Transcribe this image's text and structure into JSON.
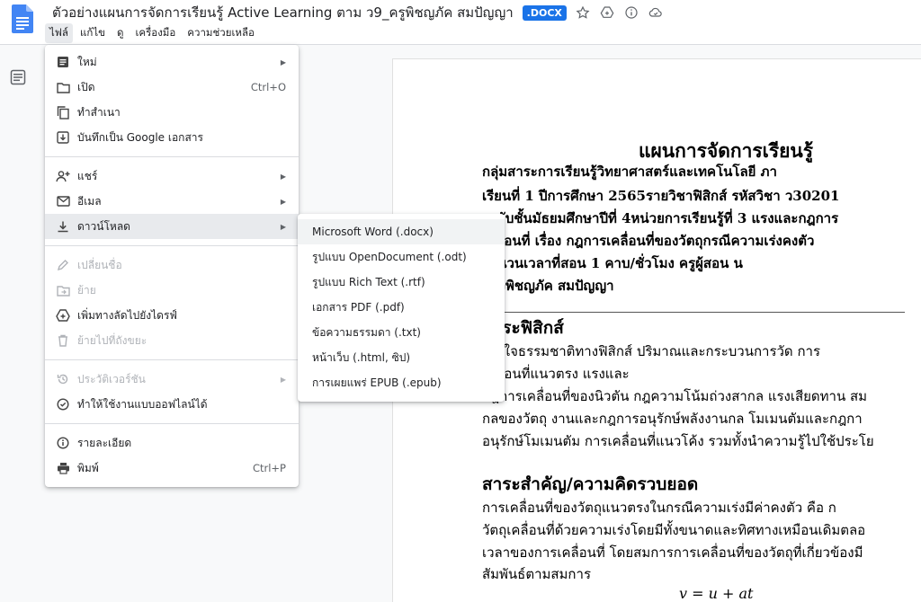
{
  "header": {
    "doc_title": "ตัวอย่างแผนการจัดการเรียนรู้ Active Learning ตาม ว9_ครูพิชญภัค สมปัญญา",
    "file_ext": ".DOCX"
  },
  "menubar": [
    "ไฟล์",
    "แก้ไข",
    "ดู",
    "เครื่องมือ",
    "ความช่วยเหลือ"
  ],
  "file_menu": {
    "group1": [
      {
        "label": "ใหม่",
        "has_submenu": true
      },
      {
        "label": "เปิด",
        "shortcut": "Ctrl+O"
      },
      {
        "label": "ทำสำเนา"
      },
      {
        "label": "บันทึกเป็น Google เอกสาร"
      }
    ],
    "group2": [
      {
        "label": "แชร์",
        "has_submenu": true
      },
      {
        "label": "อีเมล",
        "has_submenu": true
      },
      {
        "label": "ดาวน์โหลด",
        "has_submenu": true
      }
    ],
    "group3": [
      {
        "label": "เปลี่ยนชื่อ",
        "disabled": true
      },
      {
        "label": "ย้าย",
        "disabled": true
      },
      {
        "label": "เพิ่มทางลัดไปยังไดรฟ์"
      },
      {
        "label": "ย้ายไปที่ถังขยะ",
        "disabled": true
      }
    ],
    "group4": [
      {
        "label": "ประวัติเวอร์ชัน",
        "disabled": true,
        "has_submenu": true
      },
      {
        "label": "ทำให้ใช้งานแบบออฟไลน์ได้"
      }
    ],
    "group5": [
      {
        "label": "รายละเอียด"
      },
      {
        "label": "พิมพ์",
        "shortcut": "Ctrl+P"
      }
    ]
  },
  "download_menu": [
    "Microsoft Word (.docx)",
    "รูปแบบ OpenDocument (.odt)",
    "รูปแบบ Rich Text (.rtf)",
    "เอกสาร PDF (.pdf)",
    "ข้อความธรรมดา (.txt)",
    "หน้าเว็บ (.html, ซิป)",
    "การเผยแพร่ EPUB (.epub)"
  ],
  "document": {
    "title": "แผนการจัดการเรียนรู้",
    "line1": "กลุ่มสาระการเรียนรู้วิทยาศาสตร์และเทคโนโลยี                          ภา",
    "line2": "เรียนที่ 1  ปีการศึกษา  2565รายวิชาฟิสิกส์  รหัสวิชา ว30201",
    "line3": "ระดับชั้นมัธยมศึกษาปีที่ 4หน่วยการเรียนรู้ที่ 3 แรงและกฎการ",
    "line4": "เคลื่อนที่          เรื่อง กฎการเคลื่อนที่ของวัตถุกรณีความเร่งคงตัว",
    "line5": "จำนวนเวลาที่สอน  1  คาบ/ชั่วโมง                          ครูผู้สอน  น",
    "line6": "สาวพิชญภัค  สมปัญญา",
    "sec1_title": "สาระฟิสิกส์",
    "sec1_p1": "        เข้าใจธรรมชาติทางฟิสิกส์  ปริมาณและกระบวนการวัด การ",
    "sec1_p2": "เคลื่อนที่แนวตรง แรงและ",
    "sec1_p3": "กฎการเคลื่อนที่ของนิวตัน กฎความโน้มถ่วงสากล แรงเสียดทาน สม",
    "sec1_p4": "กลของวัตถุ งานและกฎการอนุรักษ์พลังงานกล โมเมนตัมและกฎกา",
    "sec1_p5": "อนุรักษ์โมเมนตัม การเคลื่อนที่แนวโค้ง รวมทั้งนำความรู้ไปใช้ประโย",
    "sec2_title": "สาระสำคัญ/ความคิดรวบยอด",
    "sec2_p1": "        การเคลื่อนที่ของวัตถุแนวตรงในกรณีความเร่งมีค่าคงตัว คือ ก",
    "sec2_p2": "วัตถุเคลื่อนที่ด้วยความเร่งโดยมีทั้งขนาดและทิศทางเหมือนเดิมตลอ",
    "sec2_p3": "เวลาของการเคลื่อนที่ โดยสมการการเคลื่อนที่ของวัตถุที่เกี่ยวข้องมี",
    "sec2_p4": "สัมพันธ์ตามสมการ",
    "formula": "v = u + at"
  },
  "colors": {
    "accent": "#1a73e8",
    "menu_highlight": "#e8eaed",
    "disabled": "#b0b3b8"
  },
  "icons": {
    "title_bar": [
      "star-icon",
      "move-to-drive-icon",
      "info-icon",
      "cloud-status-icon"
    ],
    "left_rail": "document-outline-icon"
  }
}
